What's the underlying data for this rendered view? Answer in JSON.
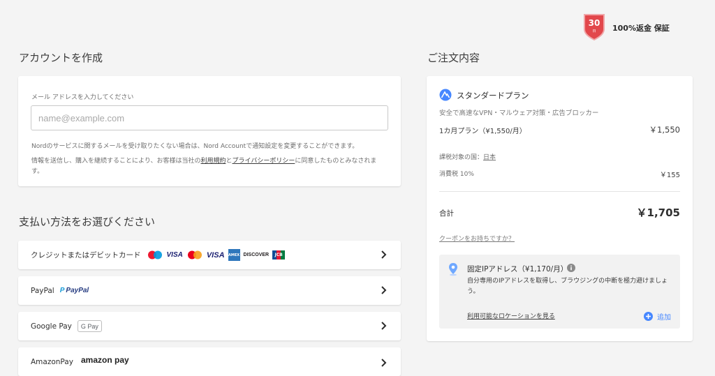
{
  "guarantee": {
    "days": "30",
    "unit": "日",
    "label": "100%返金 保証"
  },
  "account": {
    "heading": "アカウントを作成",
    "email_label": "メール アドレスを入力してください",
    "email_placeholder": "name@example.com",
    "email_value": "",
    "notice": "Nordのサービスに関するメールを受け取りたくない場合は、Nord Accountで通知設定を変更することができます。",
    "terms_prefix": "情報を送信し、購入を継続することにより、お客様は当社の",
    "terms_link": "利用規約",
    "terms_and": "と",
    "privacy_link": "プライバシーポリシー",
    "terms_suffix": "に同意したものとみなされま",
    "terms_suffix2": "す。"
  },
  "payment": {
    "heading": "支払い方法をお選びください",
    "methods": [
      {
        "label": "クレジットまたはデビットカード"
      },
      {
        "label": "PayPal",
        "logo": "PayPal"
      },
      {
        "label": "Google Pay",
        "logo": "G Pay"
      },
      {
        "label": "AmazonPay",
        "logo": "amazon pay"
      }
    ],
    "card_logos": [
      "maestro",
      "VISA",
      "mastercard",
      "VISA",
      "AMEX",
      "DISCOVER",
      "JCB"
    ]
  },
  "order": {
    "heading": "ご注文内容",
    "plan_name": "スタンダードプラン",
    "plan_desc": "安全で高速なVPN・マルウェア対策・広告ブロッカー",
    "plan_period": "1カ月プラン（¥1,550/月）",
    "plan_price": "￥1,550",
    "tax_country_label": "課税対象の国：",
    "tax_country": "日本",
    "tax_label": "消費税 10%",
    "tax_value": "￥155",
    "total_label": "合計",
    "total_value": "￥1,705",
    "coupon": "クーポンをお持ちですか？",
    "addon": {
      "title": "固定IPアドレス（¥1,170/月）",
      "desc1": "自分専用のIPアドレスを取得し、ブラウジングの中断を極力避けましょ",
      "desc2": "う。",
      "locations_link": "利用可能なロケーションを見る",
      "add_label": "追加"
    }
  },
  "colors": {
    "accent": "#4687ff",
    "badge": "#e2474b",
    "info_bg": "#f2f2f2"
  }
}
